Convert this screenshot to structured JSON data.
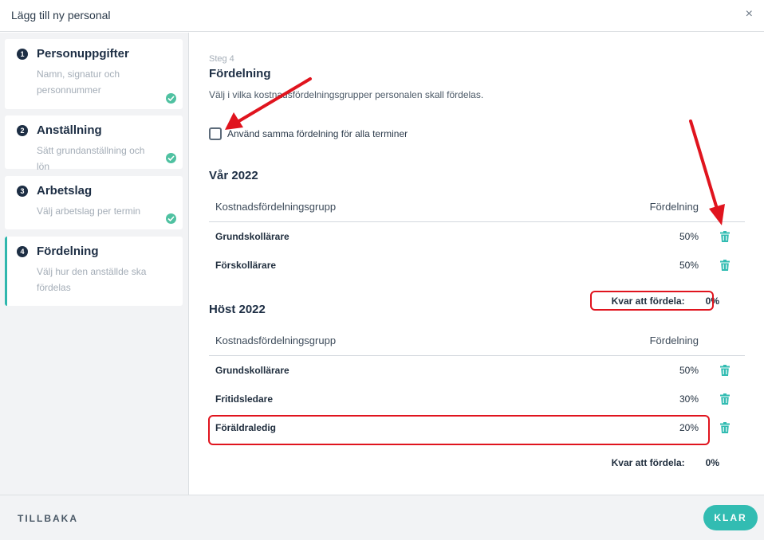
{
  "header": {
    "title": "Lägg till ny personal",
    "close_glyph": "×"
  },
  "sidebar": {
    "steps": [
      {
        "num": "1",
        "title": "Personuppgifter",
        "desc": "Namn, signatur och personnummer",
        "done": true
      },
      {
        "num": "2",
        "title": "Anställning",
        "desc": "Sätt grundanställning och lön",
        "done": true
      },
      {
        "num": "3",
        "title": "Arbetslag",
        "desc": "Välj arbetslag per termin",
        "done": true
      },
      {
        "num": "4",
        "title": "Fördelning",
        "desc": "Välj hur den anställde ska fördelas",
        "done": false,
        "active": true
      }
    ]
  },
  "content": {
    "step_label": "Steg 4",
    "title": "Fördelning",
    "description": "Välj i vilka kostnadsfördelningsgrupper personalen skall fördelas.",
    "same_distribution_label": "Använd samma fördelning för alla terminer",
    "same_distribution_checked": false,
    "column_group": "Kostnadsfördelningsgrupp",
    "column_distribution": "Fördelning",
    "remaining_label": "Kvar att fördela:",
    "terms": [
      {
        "name": "Vår 2022",
        "rows": [
          {
            "group": "Grundskollärare",
            "pct": "50%"
          },
          {
            "group": "Förskollärare",
            "pct": "50%"
          }
        ],
        "remaining": "0%"
      },
      {
        "name": "Höst 2022",
        "rows": [
          {
            "group": "Grundskollärare",
            "pct": "50%"
          },
          {
            "group": "Fritidsledare",
            "pct": "30%"
          },
          {
            "group": "Föräldraledig",
            "pct": "20%"
          }
        ],
        "remaining": "0%"
      }
    ]
  },
  "footer": {
    "back_label": "TILLBAKA",
    "done_label": "KLAR"
  },
  "colors": {
    "accent": "#32bcb2",
    "check": "#4fc1a1",
    "navy": "#1d2e44",
    "annotation": "#e0141e"
  },
  "icons": {
    "trash": "trash-icon",
    "check": "checkmark-icon",
    "close": "close-icon"
  }
}
